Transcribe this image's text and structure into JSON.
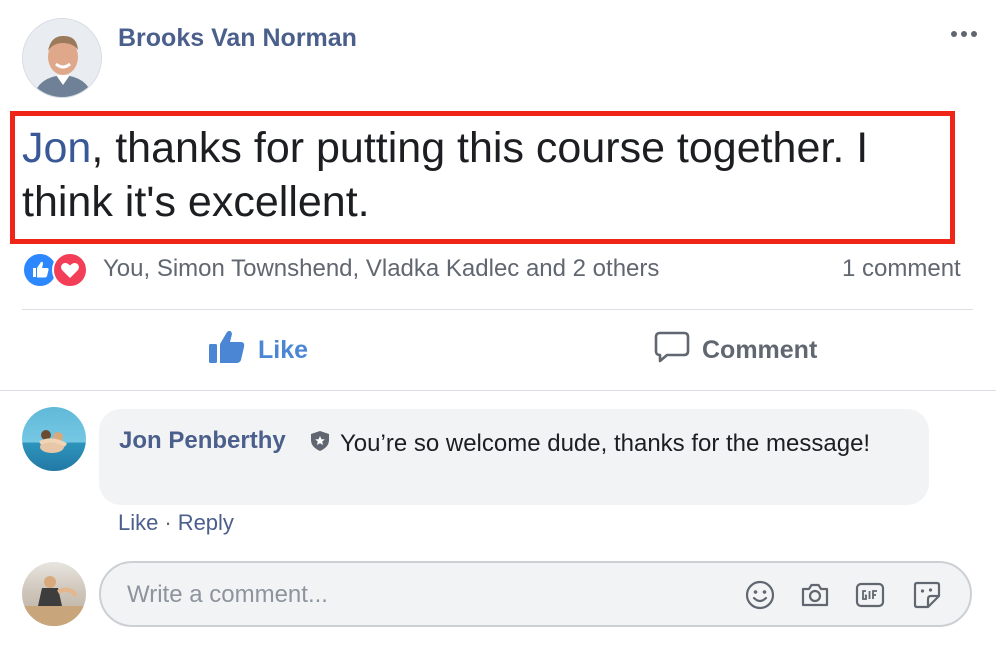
{
  "post": {
    "author": "Brooks Van Norman",
    "mention": "Jon",
    "text_after_mention": ", thanks for putting this course together. I think it's excellent.",
    "reactions": {
      "icons": [
        "like-icon",
        "love-icon"
      ],
      "names": "You, Simon Townshend, Vladka Kadlec and 2 others"
    },
    "comment_count": "1 comment"
  },
  "actions": {
    "like_label": "Like",
    "comment_label": "Comment"
  },
  "comment": {
    "author": "Jon Penberthy",
    "text": "You’re so welcome dude, thanks for the message!",
    "like_label": "Like",
    "separator": "·",
    "reply_label": "Reply"
  },
  "composer": {
    "placeholder": "Write a comment...",
    "icons": [
      "emoji-icon",
      "camera-icon",
      "gif-icon",
      "sticker-icon"
    ]
  },
  "colors": {
    "highlight_border": "#ee2517",
    "link_blue": "#4b5f8c",
    "like_blue": "#4a86d4",
    "love_red": "#f33e58"
  }
}
